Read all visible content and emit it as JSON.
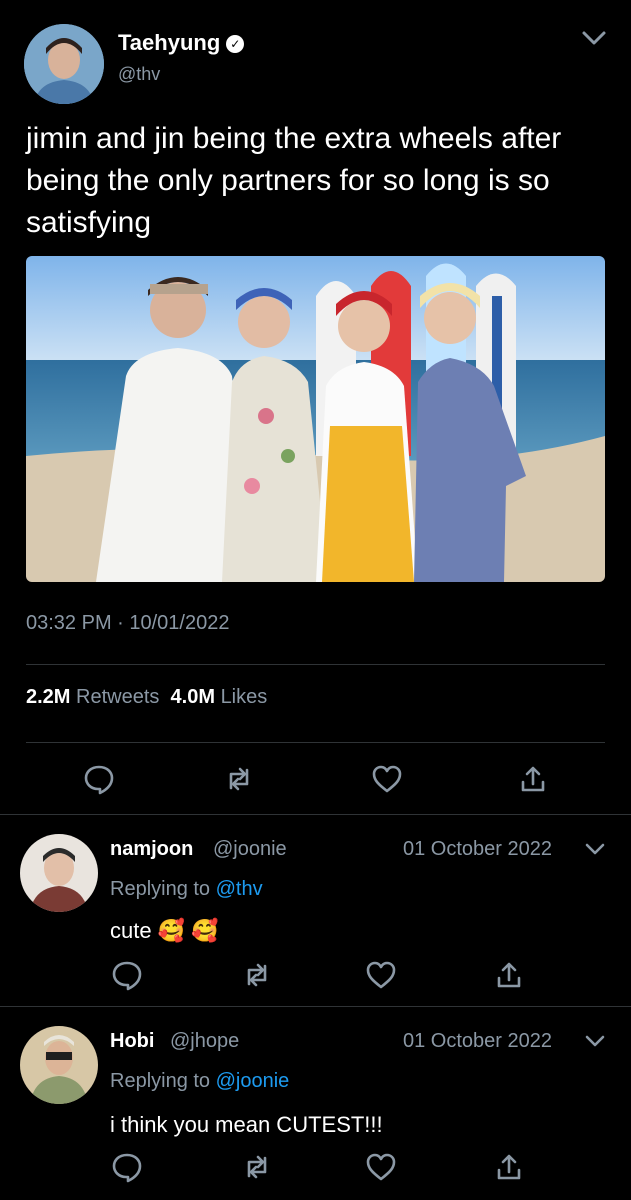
{
  "tweet": {
    "author_name": "Taehyung",
    "verified_icon": "verified-badge-icon",
    "handle": "@thv",
    "text": "jimin and jin being the extra wheels after being the only partners for so long is so satisfying",
    "timestamp": "03:32 PM · 10/01/2022",
    "retweets_count": "2.2M",
    "retweets_label": "Retweets",
    "likes_count": "4.0M",
    "likes_label": "Likes",
    "actions": [
      "reply-icon",
      "retweet-icon",
      "like-icon",
      "share-icon"
    ]
  },
  "replies": [
    {
      "name": "namjoon",
      "handle": "@joonie",
      "date": "01 October 2022",
      "replying_prefix": "Replying to",
      "replying_to": "@thv",
      "text": "cute 🥰 🥰"
    },
    {
      "name": "Hobi",
      "handle": "@jhope",
      "date": "01 October 2022",
      "replying_prefix": "Replying to",
      "replying_to": "@joonie",
      "text": "i think you mean CUTEST!!!"
    }
  ],
  "colors": {
    "background": "#000000",
    "muted_text": "#8b98a5",
    "link": "#1d9bf0",
    "divider": "#2f3336"
  }
}
